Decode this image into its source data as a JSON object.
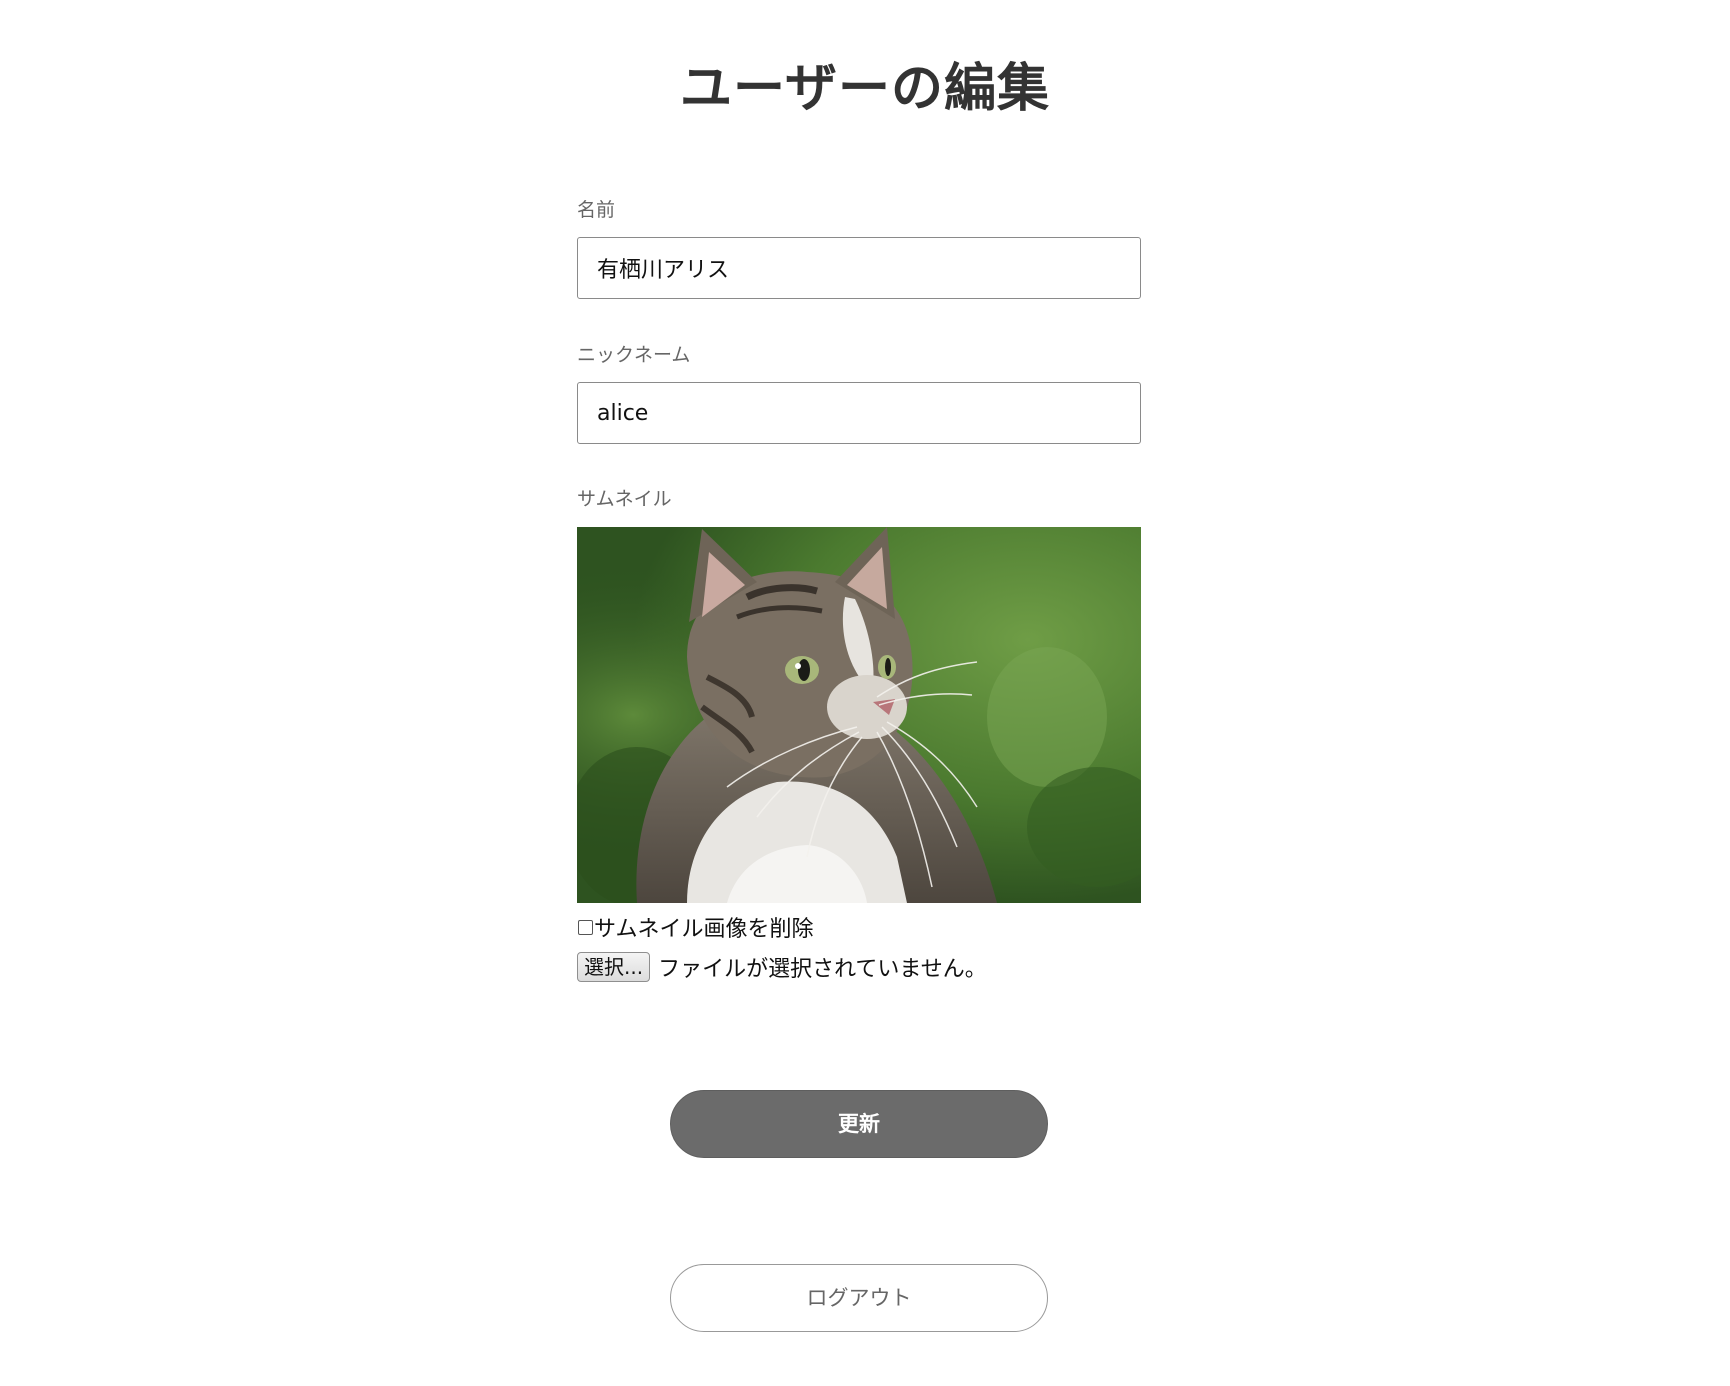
{
  "page": {
    "title": "ユーザーの編集"
  },
  "form": {
    "name": {
      "label": "名前",
      "value": "有栖川アリス"
    },
    "nickname": {
      "label": "ニックネーム",
      "value": "alice"
    },
    "thumbnail": {
      "label": "サムネイル",
      "image_icon": "tabby-cat-photo",
      "delete_label": "サムネイル画像を削除",
      "delete_checked": false,
      "file_button_label": "選択...",
      "file_status": "ファイルが選択されていません。"
    }
  },
  "actions": {
    "update_label": "更新",
    "logout_label": "ログアウト"
  },
  "colors": {
    "update_button_bg": "#6b6b6b",
    "text_primary": "#333333"
  }
}
